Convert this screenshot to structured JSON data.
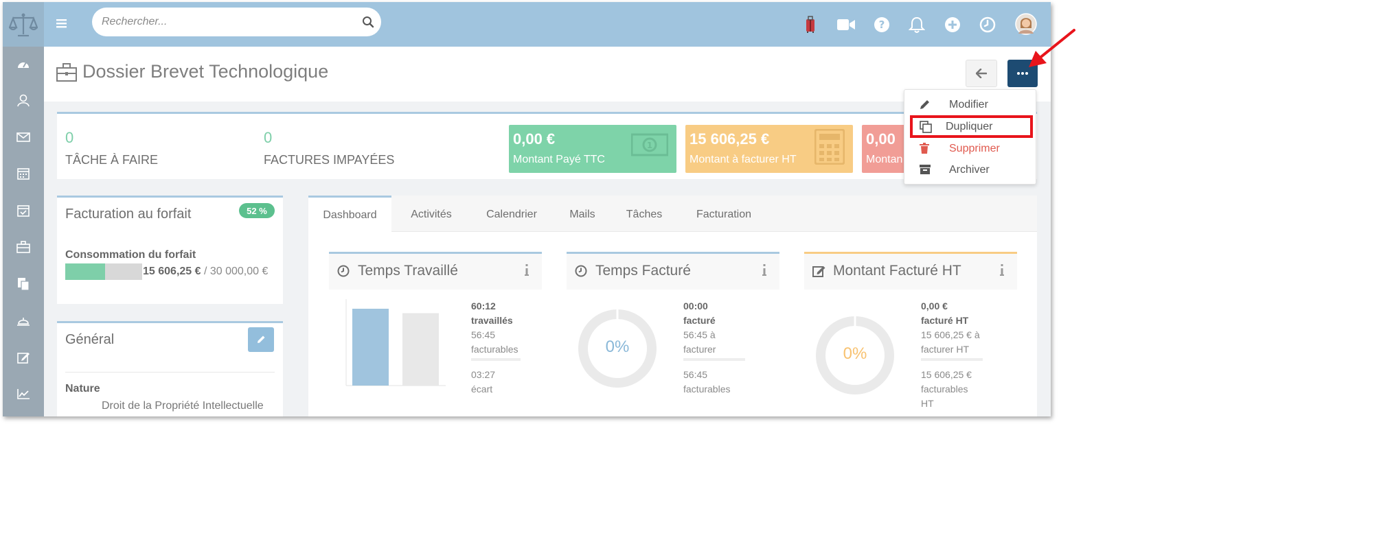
{
  "search": {
    "placeholder": "Rechercher..."
  },
  "page": {
    "title": "Dossier Brevet Technologique"
  },
  "stats": [
    {
      "value": "0",
      "label": "TÂCHE À FAIRE"
    },
    {
      "value": "0",
      "label": "FACTURES IMPAYÉES"
    }
  ],
  "stat_cards": [
    {
      "amount": "0,00 €",
      "label": "Montant Payé TTC",
      "color": "#7ed3a9"
    },
    {
      "amount": "15 606,25 €",
      "label": "Montant à facturer HT",
      "color": "#f8cc84"
    },
    {
      "amount": "0,00",
      "label": "Montan",
      "color": "#f19d96"
    }
  ],
  "forfait": {
    "title": "Facturation au forfait",
    "percent_label": "52 %",
    "percent": 0.52,
    "conso_label": "Consommation du forfait",
    "consumed": "15 606,25 €",
    "total": " / 30 000,00 €"
  },
  "general": {
    "title": "Général",
    "nature_label": "Nature",
    "nature_value": "Droit de la Propriété Intellectuelle"
  },
  "tabs": [
    "Dashboard",
    "Activités",
    "Calendrier",
    "Mails",
    "Tâches",
    "Facturation"
  ],
  "kpis": {
    "temps_travaille": {
      "title": "Temps Travaillé",
      "worked": "60:12",
      "worked_label": "travaillés",
      "billable": "56:45",
      "billable_label": "facturables",
      "gap": "03:27",
      "gap_label": "écart"
    },
    "temps_facture": {
      "title": "Temps Facturé",
      "percent_label": "0%",
      "billed": "00:00",
      "billed_label": "facturé",
      "to_bill": "56:45 à",
      "to_bill_label": "facturer",
      "billable": "56:45",
      "billable_label": "facturables"
    },
    "montant_facture": {
      "title": "Montant Facturé HT",
      "percent_label": "0%",
      "billed": "0,00 €",
      "billed_label": "facturé HT",
      "to_bill": "15 606,25 € à",
      "to_bill_label": "facturer HT",
      "billable": "15 606,25 €",
      "billable_label": "facturables",
      "billable_suffix": "HT"
    }
  },
  "menu": {
    "items": [
      {
        "label": "Modifier",
        "icon": "pencil-icon"
      },
      {
        "label": "Dupliquer",
        "icon": "copy-icon"
      },
      {
        "label": "Supprimer",
        "icon": "trash-icon",
        "color": "#e05a4f"
      },
      {
        "label": "Archiver",
        "icon": "archive-icon"
      }
    ]
  },
  "colors": {
    "topbar": "#a0c4de",
    "sidebar": "#9aa8b3",
    "accent_dark": "#1d4b72",
    "highlight": "#e8141b"
  }
}
